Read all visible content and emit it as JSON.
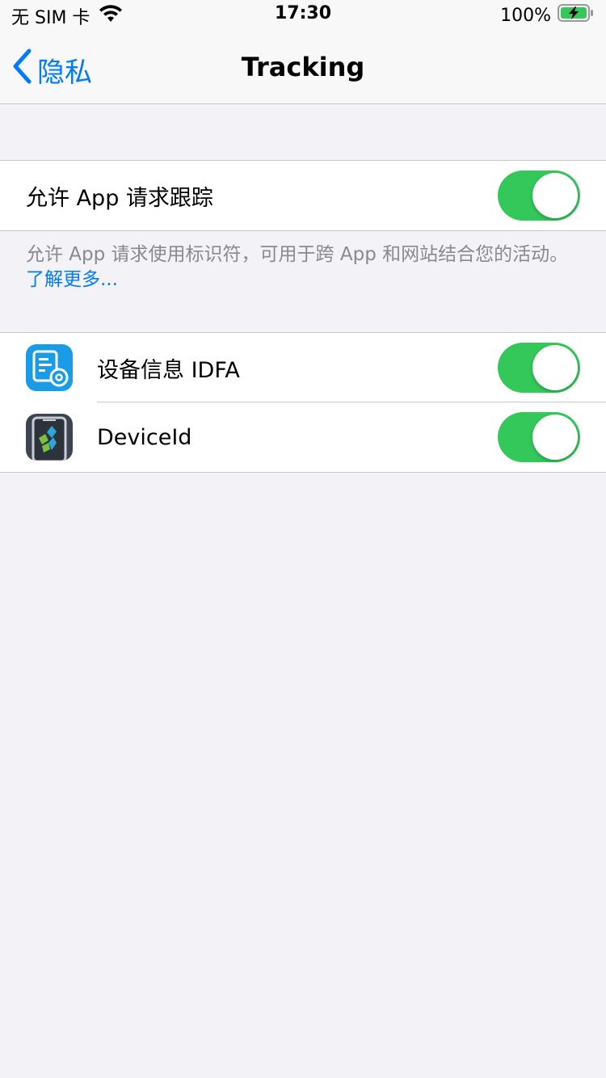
{
  "status_bar": {
    "carrier": "无 SIM 卡",
    "time": "17:30",
    "battery": "100%"
  },
  "nav": {
    "back_label": "隐私",
    "title": "Tracking"
  },
  "allow_tracking": {
    "label": "允许 App 请求跟踪",
    "enabled": true
  },
  "footnote": {
    "text": "允许 App 请求使用标识符，可用于跨 App 和网站结合您的活动。",
    "link": "了解更多..."
  },
  "apps": [
    {
      "name": "设备信息 IDFA",
      "icon": "device-info-app-icon",
      "enabled": true
    },
    {
      "name": "DeviceId",
      "icon": "deviceid-app-icon",
      "enabled": true
    }
  ],
  "colors": {
    "accent": "#007aff",
    "toggle_on": "#34c759",
    "background": "#f2f2f7",
    "battery_charging": "#34c759"
  }
}
